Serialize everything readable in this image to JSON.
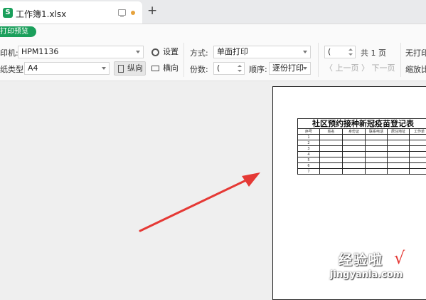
{
  "tab": {
    "icon_letter": "S",
    "title": "工作簿1.xlsx",
    "new_tab": "+"
  },
  "mode": {
    "label": "打印预览"
  },
  "printer": {
    "label": "印机:",
    "value": "HPM1136"
  },
  "paper": {
    "label": "纸类型:",
    "value": "A4"
  },
  "settings": {
    "label": "设置"
  },
  "orientation": {
    "portrait": "纵向",
    "landscape": "横向"
  },
  "method": {
    "label": "方式:",
    "value": "单面打印"
  },
  "copies": {
    "label": "份数:",
    "value": "("
  },
  "order": {
    "label": "顺序:",
    "value": "逐份打印"
  },
  "pager": {
    "current": "(",
    "total": "共 1 页",
    "prev": "上一页",
    "next": "下一页"
  },
  "scaling": {
    "value": "无打印",
    "label": "缩放比"
  },
  "preview": {
    "title": "社区预约接种新冠疫苗登记表",
    "headers": [
      "序号",
      "姓名",
      "身份证",
      "联系电话",
      "居住地址",
      "工作单"
    ],
    "rows": [
      "1",
      "2",
      "3",
      "4",
      "5",
      "6",
      "7"
    ]
  },
  "watermark": {
    "text": "经验啦",
    "check": "√",
    "url": "jingyanla.com"
  },
  "colors": {
    "accent": "#1a9f5b",
    "arrow": "#e53935",
    "dot": "#e6a23c"
  }
}
